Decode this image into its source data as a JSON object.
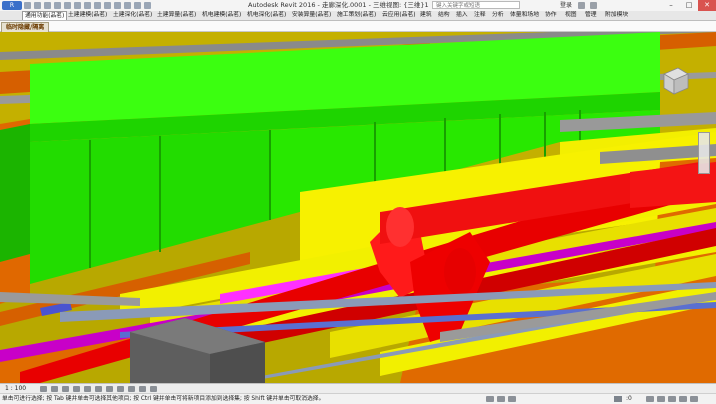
{
  "titlebar": {
    "app_button": "R",
    "title": "Autodesk Revit 2016 -    走廊深化.0001 - 三维视图: {三维}1",
    "search_placeholder": "键入关键字或短语",
    "login": "登录",
    "controls": {
      "minimize": "–",
      "maximize": "□",
      "close": "✕"
    }
  },
  "tabs": [
    {
      "label": "通用功能(品茗)",
      "active": true
    },
    {
      "label": "土建建模(品茗)"
    },
    {
      "label": "土建深化(品茗)"
    },
    {
      "label": "土建算量(品茗)"
    },
    {
      "label": "机电建模(品茗)"
    },
    {
      "label": "机电深化(品茗)"
    },
    {
      "label": "安装算量(品茗)"
    },
    {
      "label": "施工策划(品茗)"
    },
    {
      "label": "云应用(品茗)"
    },
    {
      "label": "建筑"
    },
    {
      "label": "结构"
    },
    {
      "label": "插入"
    },
    {
      "label": "注释"
    },
    {
      "label": "分析"
    },
    {
      "label": "体量和场地"
    },
    {
      "label": "协作"
    },
    {
      "label": "视图"
    },
    {
      "label": "管理"
    },
    {
      "label": "附加模块"
    }
  ],
  "doc_tab": {
    "label": "临时隐藏/隔离"
  },
  "viewcube_icon": "viewcube-icon",
  "viewbar": {
    "scale": "1 : 100"
  },
  "statusbar": {
    "hint": "单击可进行选择; 按 Tab 键并单击可选择其他项目; 按 Ctrl 键并单击可将新项目添加到选择集; 按 Shift 键并单击可取消选择。",
    "filter_value": ":0"
  },
  "colors": {
    "duct_green": "#27f300",
    "cable_tray_orange": "#e36a00",
    "fire_pipe_red": "#ee1010",
    "water_pipe_yellow": "#f6f40a",
    "pipe_magenta": "#cc00cc",
    "beam_gray": "#9a9a9a",
    "column_dark": "#6f6f6f"
  }
}
